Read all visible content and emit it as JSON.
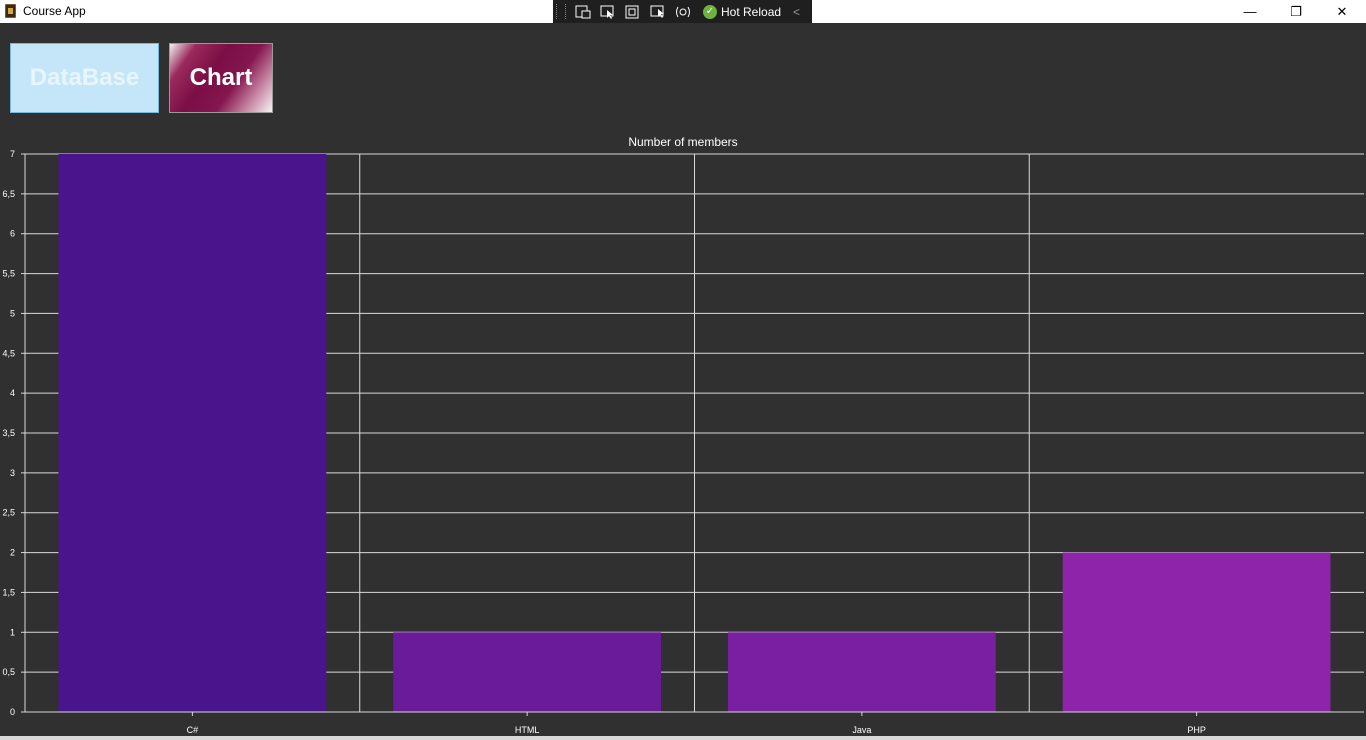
{
  "window": {
    "title": "Course App",
    "devbar_label": "Hot Reload",
    "controls": {
      "minimize": "—",
      "maximize": "❐",
      "close": "✕"
    }
  },
  "buttons": {
    "database": "DataBase",
    "chart": "Chart"
  },
  "chart_data": {
    "type": "bar",
    "title": "Number of members",
    "categories": [
      "C#",
      "HTML",
      "Java",
      "PHP"
    ],
    "values": [
      7,
      1,
      1,
      2
    ],
    "ylim": [
      0,
      7
    ],
    "yticks": [
      "0",
      "0,5",
      "1",
      "1,5",
      "2",
      "2,5",
      "3",
      "3,5",
      "4",
      "4,5",
      "5",
      "5,5",
      "6",
      "6,5",
      "7"
    ],
    "colors": [
      "#4a148c",
      "#6a1b9a",
      "#7b1fa2",
      "#8e24aa"
    ],
    "grid": true,
    "xlabel": "",
    "ylabel": ""
  }
}
